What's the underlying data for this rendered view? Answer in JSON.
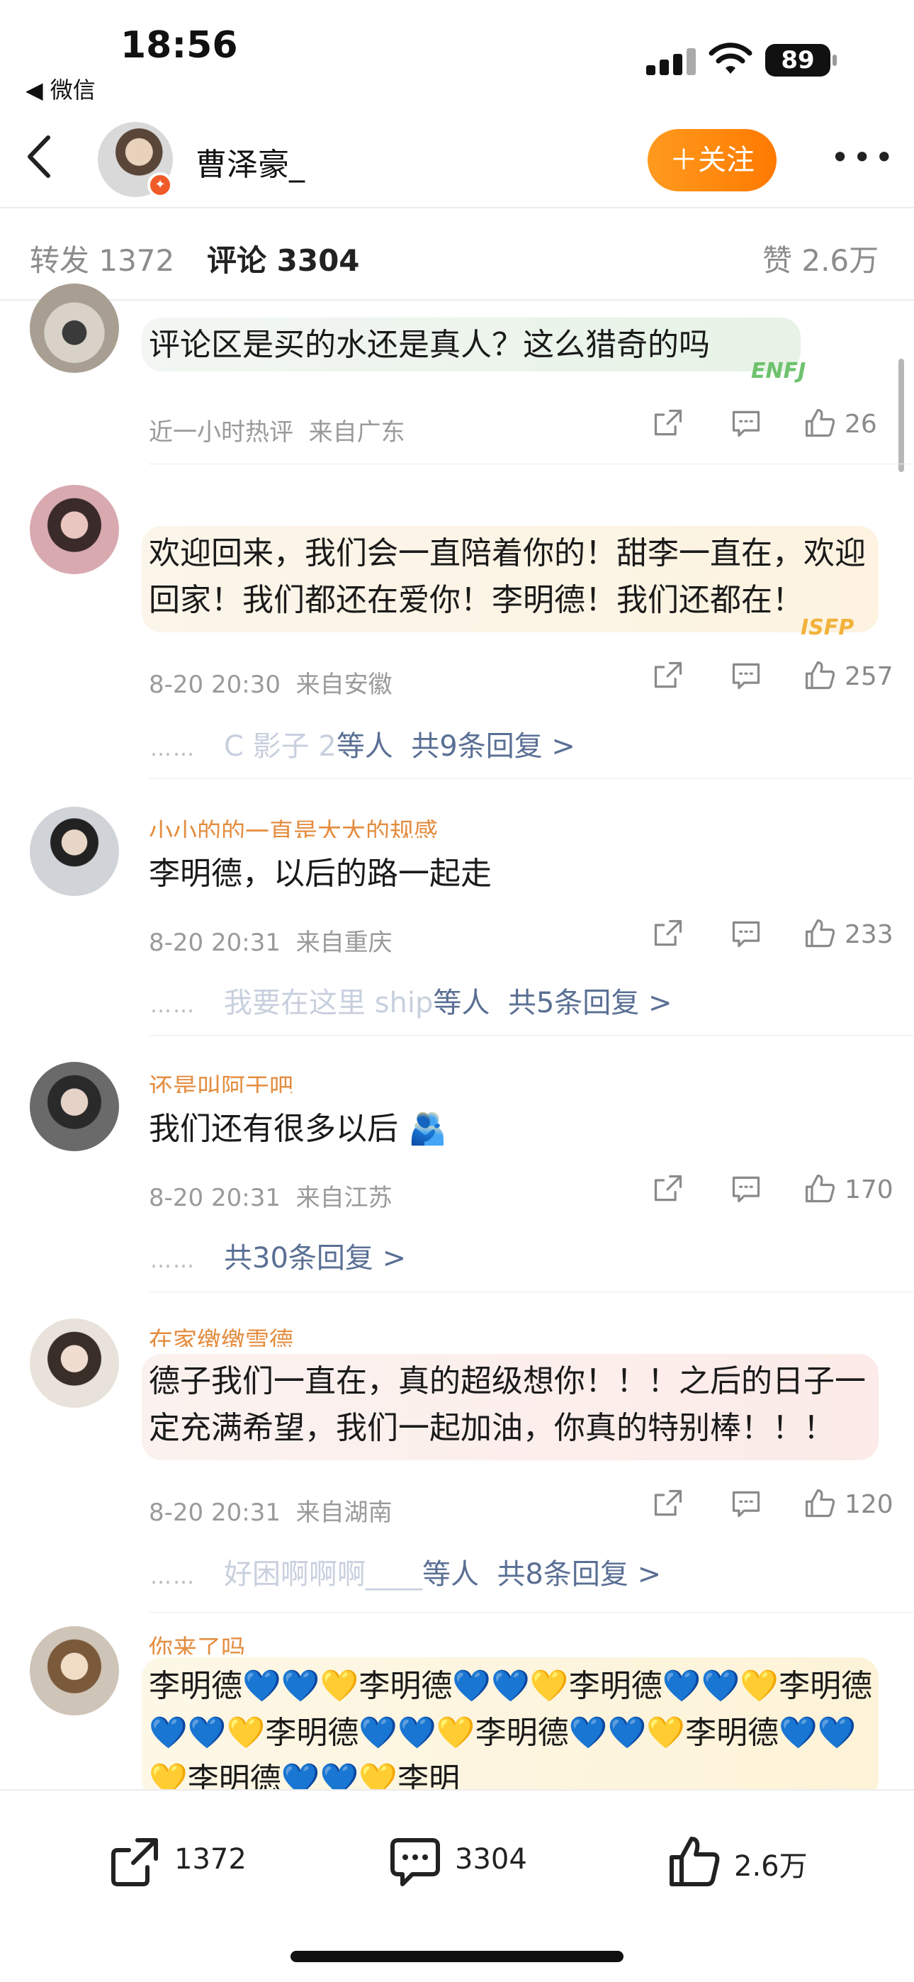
{
  "status_bar": {
    "time": "18:56",
    "back_app": "◀ 微信",
    "battery": "89"
  },
  "header": {
    "name": "曹泽豪_",
    "follow_label": "＋关注",
    "more": "•••"
  },
  "tabs": [
    {
      "label": "转发 1372"
    },
    {
      "label": "评论 3304"
    },
    {
      "label": "赞 2.6万"
    }
  ],
  "comments": [
    {
      "name": "",
      "text": "评论区是买的水还是真人？这么猎奇的吗",
      "tag": "ENFJ",
      "time": "近一小时热评",
      "location": "来自广东",
      "likes": "26",
      "replies": ""
    },
    {
      "name": "",
      "text": "欢迎回来，我们会一直陪着你的！甜李一直在，欢迎回家！我们都还在爱你！李明德！我们还都在！",
      "tag": "ISFP",
      "time": "8-20 20:30",
      "location": "来自安徽",
      "likes": "257",
      "replies_blur": "C 影子 2",
      "replies_mid": "等人",
      "replies": "共9条回复 >"
    },
    {
      "name": "小小的的一直是大大的规感",
      "text": "李明德，以后的路一起走",
      "tag": "",
      "time": "8-20 20:31",
      "location": "来自重庆",
      "likes": "233",
      "replies_blur": "我要在这里 ship",
      "replies_mid": "等人",
      "replies": "共5条回复 >"
    },
    {
      "name": "还是叫阿于吧",
      "text": "我们还有很多以后 🫂",
      "tag": "",
      "time": "8-20 20:31",
      "location": "来自江苏",
      "likes": "170",
      "replies_blur": "",
      "replies_mid": "",
      "replies": "共30条回复 >"
    },
    {
      "name": "在家缴缴雪德",
      "text": "德子我们一直在，真的超级想你！！！之后的日子一定充满希望，我们一起加油，你真的特别棒！！！",
      "tag": "",
      "time": "8-20 20:31",
      "location": "来自湖南",
      "likes": "120",
      "replies_blur": "好困啊啊啊____",
      "replies_mid": "等人",
      "replies": "共8条回复 >"
    },
    {
      "name": "你来了吗",
      "text": "李明德💙💙💛李明德💙💙💛李明德💙💙💛李明德💙💙💛李明德💙💙💛李明德💙💙💛李明德💙💙💛李明德💙💙💛李明",
      "tag": "",
      "time": "",
      "location": "",
      "likes": "",
      "replies": ""
    }
  ],
  "bottom_bar": {
    "reposts": "1372",
    "comments": "3304",
    "likes": "2.6万"
  },
  "colors": {
    "accent_orange": "#ff8a00",
    "link_blue": "#5a6f94",
    "name_orange": "#e07a1f"
  }
}
